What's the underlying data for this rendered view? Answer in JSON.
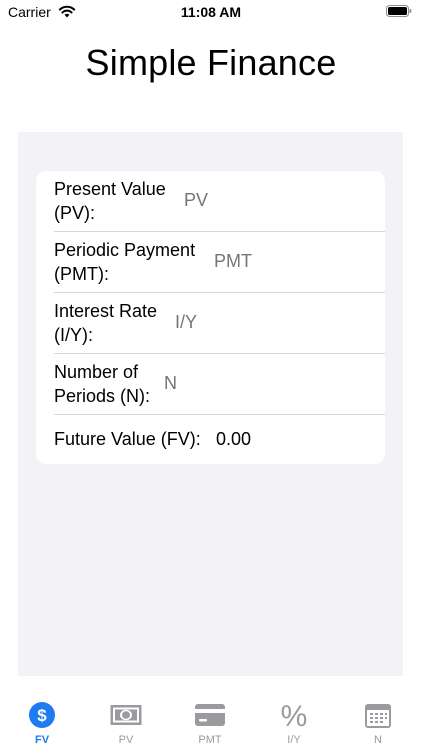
{
  "status_bar": {
    "carrier": "Carrier",
    "time": "11:08 AM"
  },
  "app": {
    "title": "Simple Finance"
  },
  "form": {
    "present_value": {
      "label": "Present Value (PV):",
      "placeholder": "PV",
      "value": ""
    },
    "periodic_payment": {
      "label": "Periodic Payment (PMT):",
      "placeholder": "PMT",
      "value": ""
    },
    "interest_rate": {
      "label": "Interest Rate (I/Y):",
      "placeholder": "I/Y",
      "value": ""
    },
    "number_of_periods": {
      "label": "Number of Periods (N):",
      "placeholder": "N",
      "value": ""
    },
    "future_value": {
      "label": "Future Value (FV):",
      "value": "0.00"
    }
  },
  "tabs": [
    {
      "label": "FV",
      "icon": "dollar-circle-icon",
      "active": true
    },
    {
      "label": "PV",
      "icon": "banknote-icon",
      "active": false
    },
    {
      "label": "PMT",
      "icon": "credit-card-icon",
      "active": false
    },
    {
      "label": "I/Y",
      "icon": "percent-icon",
      "active": false
    },
    {
      "label": "N",
      "icon": "calendar-icon",
      "active": false
    }
  ],
  "colors": {
    "accent": "#1f7bf0",
    "inactive_tab": "#9a9a9f",
    "content_background": "#f2f2f7",
    "placeholder": "#c7c7cc"
  }
}
